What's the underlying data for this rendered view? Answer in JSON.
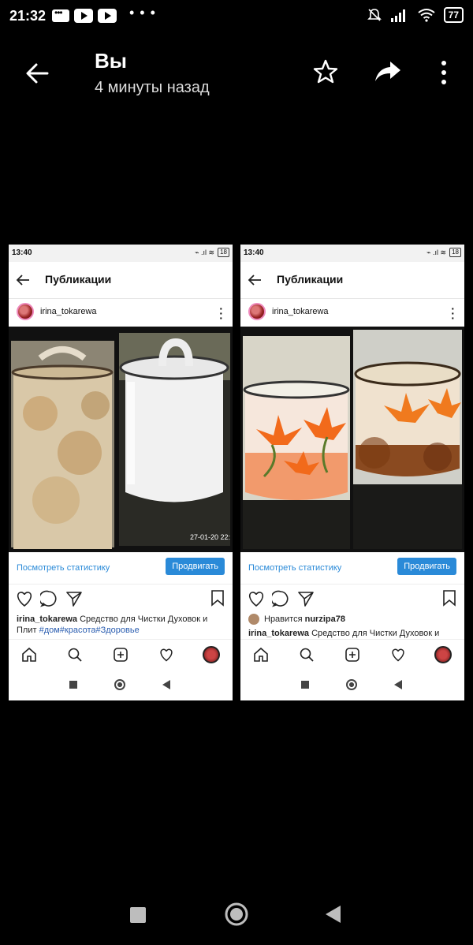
{
  "status_bar": {
    "time": "21:32",
    "battery": "77"
  },
  "header": {
    "title": "Вы",
    "subtitle": "4 минуты назад"
  },
  "screenshots": [
    {
      "status_time": "13:40",
      "status_battery": "18",
      "header_title": "Публикации",
      "username": "irina_tokarewa",
      "photo_timestamp": "27-01-20 22:",
      "stats_link": "Посмотреть статистику",
      "promote_button": "Продвигать",
      "caption_user": "irina_tokarewa",
      "caption_text": "Средство для Чистки Духовок и Плит",
      "hashtags": "#дом#красота#Здоровье"
    },
    {
      "status_time": "13:40",
      "status_battery": "18",
      "header_title": "Публикации",
      "username": "irina_tokarewa",
      "stats_link": "Посмотреть статистику",
      "promote_button": "Продвигать",
      "likes_prefix": "Нравится",
      "likes_user": "nurzipa78",
      "caption_user": "irina_tokarewa",
      "caption_text": "Средство для Чистки Духовок и"
    }
  ],
  "icons": {
    "back": "arrow-left-icon",
    "star": "star-icon",
    "share": "share-icon",
    "more": "more-vert-icon",
    "like": "heart-icon",
    "comment": "comment-icon",
    "send": "send-icon",
    "save": "bookmark-icon",
    "home": "home-icon",
    "search": "search-icon",
    "add": "add-icon",
    "activity": "heart-icon",
    "profile": "avatar"
  }
}
